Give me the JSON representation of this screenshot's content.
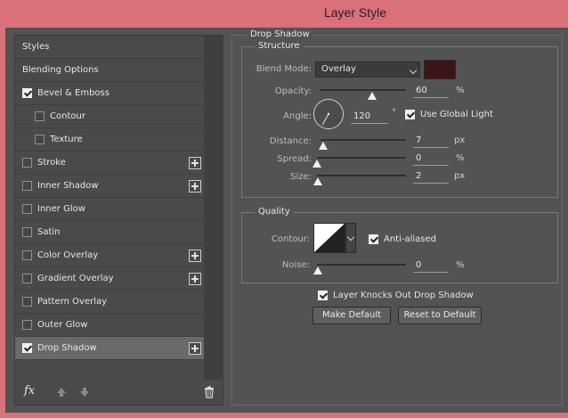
{
  "window": {
    "title": "Layer Style"
  },
  "styles_panel": {
    "items": [
      {
        "label": "Styles",
        "has_checkbox": false,
        "checked": false,
        "indent": false,
        "has_add": false,
        "active": false
      },
      {
        "label": "Blending Options",
        "has_checkbox": false,
        "checked": false,
        "indent": false,
        "has_add": false,
        "active": false
      },
      {
        "label": "Bevel & Emboss",
        "has_checkbox": true,
        "checked": true,
        "indent": false,
        "has_add": false,
        "active": false
      },
      {
        "label": "Contour",
        "has_checkbox": true,
        "checked": false,
        "indent": true,
        "has_add": false,
        "active": false
      },
      {
        "label": "Texture",
        "has_checkbox": true,
        "checked": false,
        "indent": true,
        "has_add": false,
        "active": false
      },
      {
        "label": "Stroke",
        "has_checkbox": true,
        "checked": false,
        "indent": false,
        "has_add": true,
        "active": false
      },
      {
        "label": "Inner Shadow",
        "has_checkbox": true,
        "checked": false,
        "indent": false,
        "has_add": true,
        "active": false
      },
      {
        "label": "Inner Glow",
        "has_checkbox": true,
        "checked": false,
        "indent": false,
        "has_add": false,
        "active": false
      },
      {
        "label": "Satin",
        "has_checkbox": true,
        "checked": false,
        "indent": false,
        "has_add": false,
        "active": false
      },
      {
        "label": "Color Overlay",
        "has_checkbox": true,
        "checked": false,
        "indent": false,
        "has_add": true,
        "active": false
      },
      {
        "label": "Gradient Overlay",
        "has_checkbox": true,
        "checked": false,
        "indent": false,
        "has_add": true,
        "active": false
      },
      {
        "label": "Pattern Overlay",
        "has_checkbox": true,
        "checked": false,
        "indent": false,
        "has_add": false,
        "active": false
      },
      {
        "label": "Outer Glow",
        "has_checkbox": true,
        "checked": false,
        "indent": false,
        "has_add": false,
        "active": false
      },
      {
        "label": "Drop Shadow",
        "has_checkbox": true,
        "checked": true,
        "indent": false,
        "has_add": true,
        "active": true
      }
    ],
    "toolbar": {
      "fx_label": "fx",
      "icons": [
        "fx-icon",
        "arrow-up-icon",
        "arrow-down-icon",
        "trash-icon"
      ]
    }
  },
  "drop_shadow": {
    "section_title": "Drop Shadow",
    "structure": {
      "title": "Structure",
      "blend_mode_label": "Blend Mode:",
      "blend_mode_value": "Overlay",
      "shadow_color": "#3d1418",
      "opacity_label": "Opacity:",
      "opacity_value": "60",
      "opacity_unit": "%",
      "angle_label": "Angle:",
      "angle_value": "120",
      "angle_unit": "°",
      "use_global_light_label": "Use Global Light",
      "use_global_light_checked": true,
      "distance_label": "Distance:",
      "distance_value": "7",
      "distance_unit": "px",
      "spread_label": "Spread:",
      "spread_value": "0",
      "spread_unit": "%",
      "size_label": "Size:",
      "size_value": "2",
      "size_unit": "px"
    },
    "quality": {
      "title": "Quality",
      "contour_label": "Contour:",
      "anti_aliased_label": "Anti-aliased",
      "anti_aliased_checked": true,
      "noise_label": "Noise:",
      "noise_value": "0",
      "noise_unit": "%"
    },
    "layer_knocks_out_label": "Layer Knocks Out Drop Shadow",
    "layer_knocks_out_checked": true,
    "make_default_label": "Make Default",
    "reset_default_label": "Reset to Default"
  },
  "colors": {
    "title_bar": "#d9707a",
    "panel_bg": "#535353",
    "accent_text": "#e6e6e6"
  }
}
